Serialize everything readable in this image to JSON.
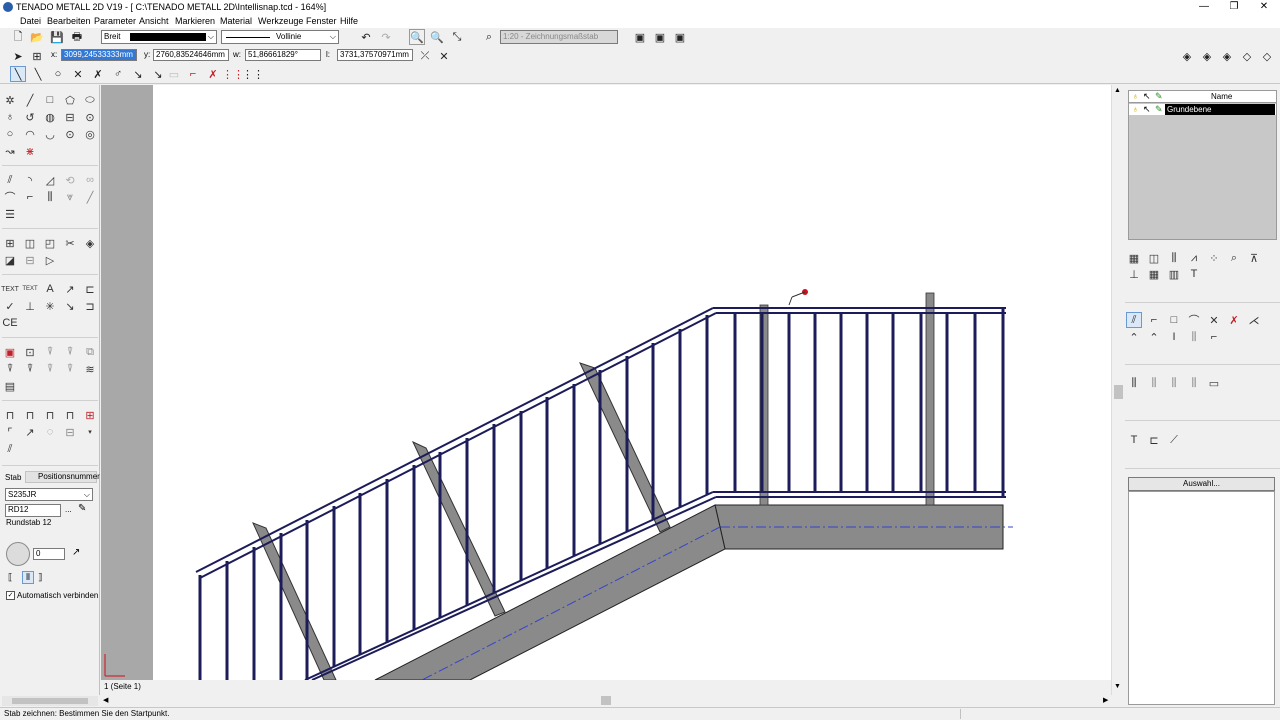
{
  "window": {
    "title": "TENADO METALL 2D V19 - [ C:\\TENADO METALL 2D\\Intellisnap.tcd - 164%]",
    "minimize": "—",
    "restore": "❐",
    "close": "✕"
  },
  "menu": [
    "Datei",
    "Bearbeiten",
    "Parameter",
    "Ansicht",
    "Markieren",
    "Material",
    "Werkzeuge",
    "Fenster",
    "Hilfe"
  ],
  "toolbar": {
    "pen_combo": "Breit",
    "line_combo": "Vollinie",
    "scale_label": "1:20 - Zeichnungsmaßstab"
  },
  "coords": {
    "x_label": "x:",
    "x_value": "3099,24533333mm",
    "y_label": "y:",
    "y_value": "2760,83524646mm",
    "w_label": "w:",
    "w_value": "51,86661829°",
    "l_label": "l:",
    "l_value": "3731,37570971mm"
  },
  "left_panel": {
    "tab_stab": "Stab",
    "tab_position": "Positionsnummer",
    "material_value": "S235JR",
    "profile_value": "RD12",
    "profile_more": "...",
    "profile_name": "Rundstab 12",
    "angle_value": "0",
    "auto_connect_label": "Automatisch verbinden"
  },
  "layers": {
    "column_name": "Name",
    "layer_name": "Grundebene"
  },
  "right_panel": {
    "auswahl_label": "Auswahl..."
  },
  "page_tab": "1 (Seite 1)",
  "status": "Stab zeichnen: Bestimmen Sie den Startpunkt."
}
